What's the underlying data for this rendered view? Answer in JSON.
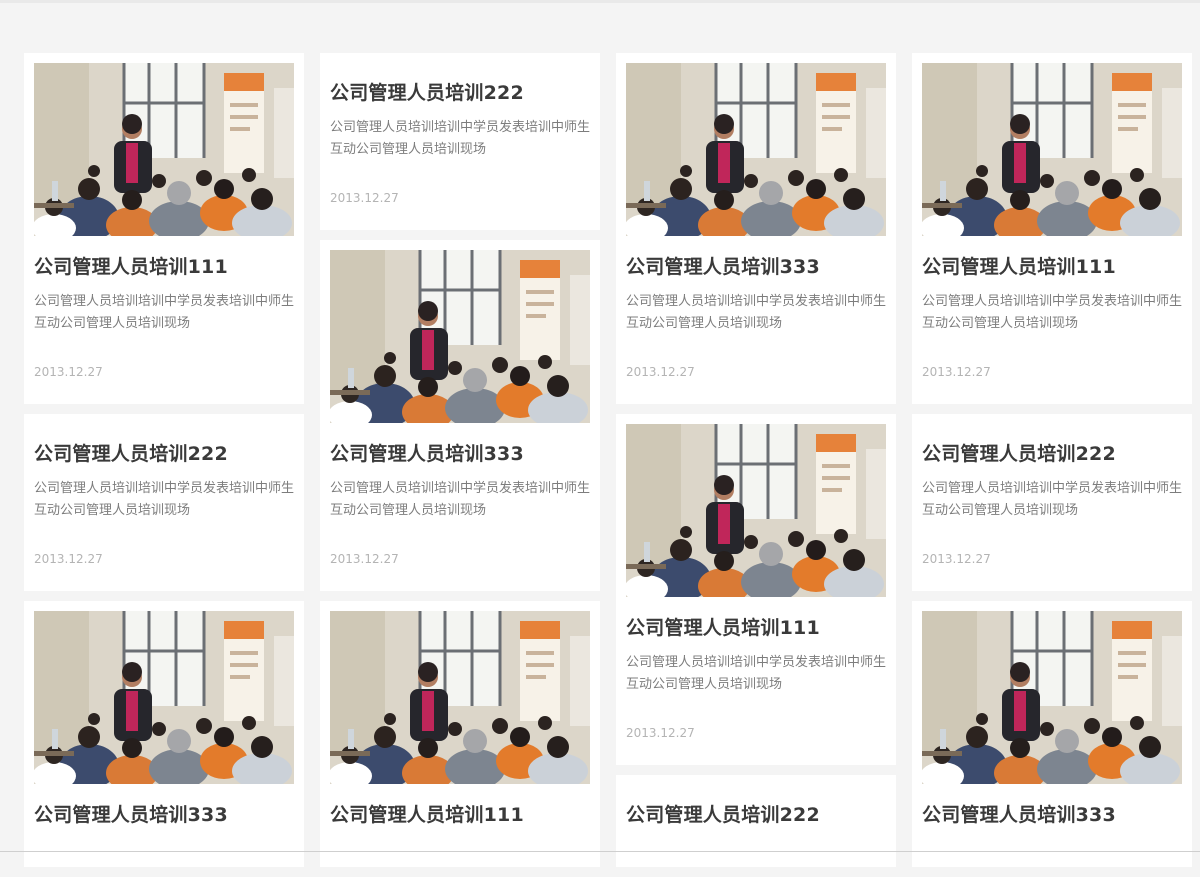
{
  "photo_alt": "公司管理人员培训",
  "columns": [
    {
      "cards": [
        {
          "has_photo": true,
          "title": "公司管理人员培训111",
          "desc": "公司管理人员培训培训中学员发表培训中师生互动公司管理人员培训现场",
          "date": "2013.12.27"
        },
        {
          "has_photo": false,
          "title": "公司管理人员培训222",
          "desc": "公司管理人员培训培训中学员发表培训中师生互动公司管理人员培训现场",
          "date": "2013.12.27"
        },
        {
          "has_photo": true,
          "title": "公司管理人员培训333",
          "desc": "",
          "date": ""
        }
      ]
    },
    {
      "cards": [
        {
          "has_photo": false,
          "title": "公司管理人员培训222",
          "desc": "公司管理人员培训培训中学员发表培训中师生互动公司管理人员培训现场",
          "date": "2013.12.27"
        },
        {
          "has_photo": true,
          "title": "公司管理人员培训333",
          "desc": "公司管理人员培训培训中学员发表培训中师生互动公司管理人员培训现场",
          "date": "2013.12.27"
        },
        {
          "has_photo": true,
          "title": "公司管理人员培训111",
          "desc": "",
          "date": ""
        }
      ]
    },
    {
      "cards": [
        {
          "has_photo": true,
          "title": "公司管理人员培训333",
          "desc": "公司管理人员培训培训中学员发表培训中师生互动公司管理人员培训现场",
          "date": "2013.12.27"
        },
        {
          "has_photo": true,
          "title": "公司管理人员培训111",
          "desc": "公司管理人员培训培训中学员发表培训中师生互动公司管理人员培训现场",
          "date": "2013.12.27"
        },
        {
          "has_photo": false,
          "title": "公司管理人员培训222",
          "desc": "",
          "date": ""
        }
      ]
    },
    {
      "cards": [
        {
          "has_photo": true,
          "title": "公司管理人员培训111",
          "desc": "公司管理人员培训培训中学员发表培训中师生互动公司管理人员培训现场",
          "date": "2013.12.27"
        },
        {
          "has_photo": false,
          "title": "公司管理人员培训222",
          "desc": "公司管理人员培训培训中学员发表培训中师生互动公司管理人员培训现场",
          "date": "2013.12.27"
        },
        {
          "has_photo": true,
          "title": "公司管理人员培训333",
          "desc": "",
          "date": ""
        }
      ]
    }
  ]
}
